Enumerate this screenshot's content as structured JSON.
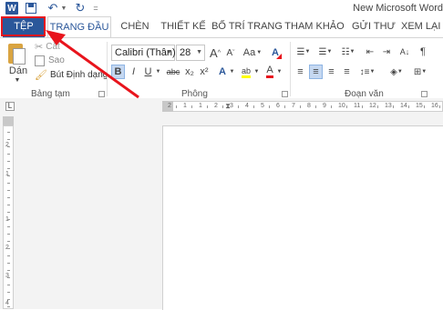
{
  "titlebar": {
    "app_icon_text": "W",
    "window_title": "New Microsoft Word"
  },
  "tabs": [
    "TỆP",
    "TRANG ĐẦU",
    "CHÈN",
    "THIẾT KẾ",
    "BỐ TRÍ TRANG",
    "THAM KHẢO",
    "GỬI THƯ",
    "XEM LẠI"
  ],
  "clipboard": {
    "paste_label": "Dán",
    "cut_label": "Cắt",
    "copy_label": "Sao",
    "format_painter_label": "Bút Định dạng",
    "group_label": "Bảng tạm"
  },
  "font": {
    "font_name": "Calibri (Thân)",
    "font_size": "28",
    "grow_label": "A",
    "shrink_label": "A",
    "case_label": "Aa",
    "bold_label": "B",
    "italic_label": "I",
    "underline_label": "U",
    "strike_label": "abc",
    "subscript_label": "x₂",
    "superscript_label": "x²",
    "effects_label": "A",
    "highlight_label": "ab",
    "color_label": "A",
    "group_label": "Phông"
  },
  "paragraph": {
    "group_label": "Đoạn văn"
  },
  "rulers": {
    "horizontal": [
      "2",
      "1",
      "1",
      "2",
      "3",
      "4",
      "5",
      "6",
      "7",
      "8",
      "9",
      "10",
      "11",
      "12",
      "13",
      "14",
      "15",
      "16"
    ],
    "vertical": [
      "2",
      "1",
      "1",
      "2",
      "3",
      "4"
    ]
  },
  "colors": {
    "accent": "#2b579a",
    "annotation": "#e8141c",
    "highlight_yellow": "#ffff00",
    "font_color_red": "#e8141c"
  }
}
